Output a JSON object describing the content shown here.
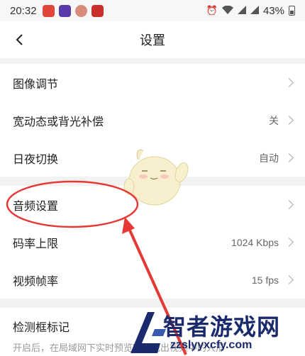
{
  "status_bar": {
    "time": "20:32",
    "battery": "43%",
    "icons": [
      "app-icon-red",
      "app-icon-purple",
      "app-icon-avatar",
      "app-icon-red-logo",
      "alarm-icon",
      "wifi-icon",
      "signal-icon",
      "signal-icon",
      "battery-icon"
    ]
  },
  "header": {
    "title": "设置",
    "back_icon": "back-chevron-icon"
  },
  "groups": [
    {
      "items": [
        {
          "label": "图像调节",
          "value": ""
        },
        {
          "label": "宽动态或背光补偿",
          "value": "关"
        },
        {
          "label": "日夜切换",
          "value": "自动"
        }
      ]
    },
    {
      "items": [
        {
          "label": "音频设置",
          "value": ""
        },
        {
          "label": "码率上限",
          "value": "1024 Kbps"
        },
        {
          "label": "视频帧率",
          "value": "15 fps"
        }
      ]
    },
    {
      "items": [
        {
          "label": "检测框标记",
          "description": "开启后，在局域网下实时预览时标记出视频中的人形"
        }
      ]
    }
  ],
  "watermark": {
    "title": "智者游戏网",
    "url": "zzslyyxcfy.com"
  },
  "annotation_color": "#e53935"
}
